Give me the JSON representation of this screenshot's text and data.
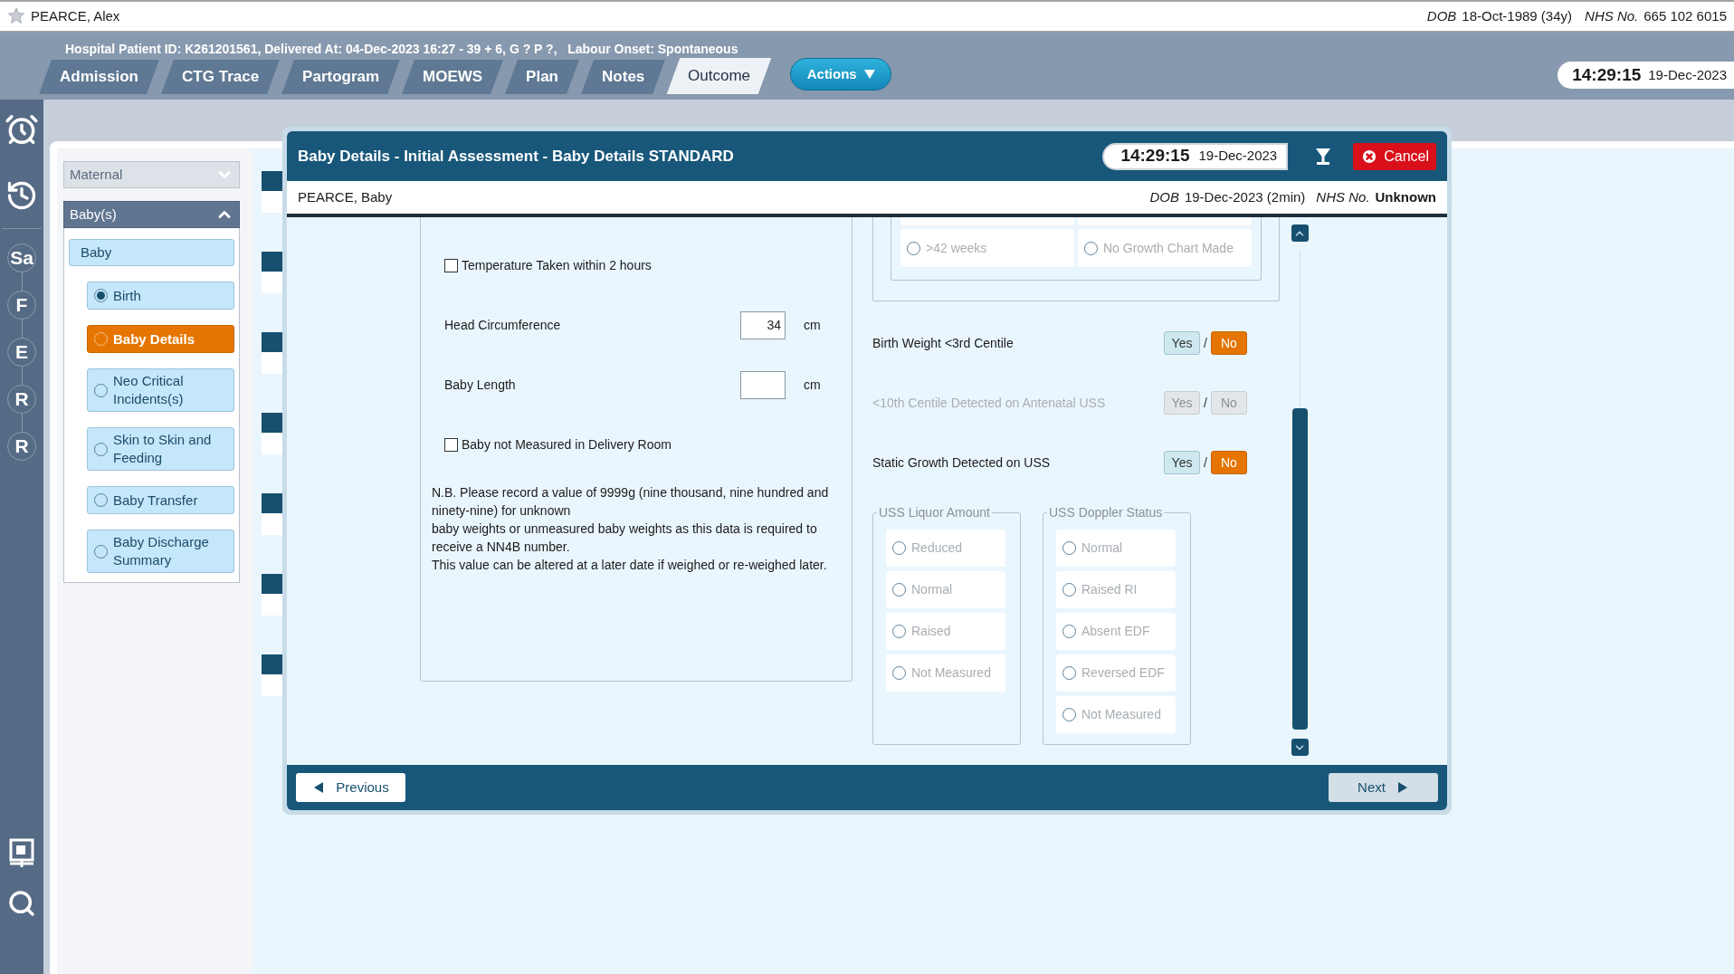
{
  "patient_bar": {
    "name": "PEARCE, Alex",
    "dob_label": "DOB",
    "dob": "18-Oct-1989 (34y)",
    "nhs_label": "NHS No.",
    "nhs": "665 102 6015"
  },
  "info_line": "Hospital Patient ID: K261201561, Delivered At: 04-Dec-2023 16:27 - 39 + 6, G ? P ?,   Labour Onset: Spontaneous",
  "tabs": [
    {
      "label": "Admission",
      "selected": false
    },
    {
      "label": "CTG Trace",
      "selected": false
    },
    {
      "label": "Partogram",
      "selected": false
    },
    {
      "label": "MOEWS",
      "selected": false
    },
    {
      "label": "Plan",
      "selected": false
    },
    {
      "label": "Notes",
      "selected": false
    },
    {
      "label": "Outcome",
      "selected": true
    }
  ],
  "actions_button": "Actions",
  "clock": {
    "time": "14:29:15",
    "date": "19-Dec-2023"
  },
  "rail_letters": [
    "Sa",
    "F",
    "E",
    "R",
    "R"
  ],
  "nav": {
    "sections": [
      {
        "label": "Maternal",
        "expanded": false
      },
      {
        "label": "Baby(s)",
        "expanded": true
      }
    ],
    "baby": "Baby",
    "items": [
      {
        "label": "Birth",
        "checked": true,
        "selected": false
      },
      {
        "label": "Baby Details",
        "checked": false,
        "selected": true
      },
      {
        "label": "Neo Critical Incidents(s)",
        "checked": false,
        "selected": false
      },
      {
        "label": "Skin to Skin and Feeding",
        "checked": false,
        "selected": false
      },
      {
        "label": "Baby Transfer",
        "checked": false,
        "selected": false
      },
      {
        "label": "Baby Discharge Summary",
        "checked": false,
        "selected": false
      }
    ]
  },
  "dialog": {
    "title": "Baby Details - Initial Assessment - Baby Details STANDARD",
    "clock": {
      "time": "14:29:15",
      "date": "19-Dec-2023"
    },
    "cancel": "Cancel",
    "baby": {
      "name": "PEARCE, Baby",
      "dob_label": "DOB",
      "dob": "19-Dec-2023 (2min)",
      "nhs_label": "NHS No.",
      "nhs": "Unknown"
    },
    "fields": [
      {
        "kind": "checkbox",
        "label": "Temperature Taken within 2 hours",
        "checked": false
      },
      {
        "kind": "number",
        "label": "Head Circumference",
        "value": "34",
        "unit": "cm"
      },
      {
        "kind": "number",
        "label": "Baby Length",
        "unit": "cm"
      },
      {
        "kind": "checkbox",
        "label": "Baby not Measured in Delivery Room",
        "checked": false
      }
    ],
    "note": [
      "N.B. Please record a value of 9999g (nine thousand, nine hundred and ninety-nine) for unknown",
      "baby weights or unmeasured baby weights as this data is required to receive a NN4B number.",
      "This value can be altered at a later date if weighed or re-weighed later."
    ],
    "growth_options": [
      {
        "label": ">42 weeks",
        "checked": false,
        "disabled": true
      },
      {
        "label": "No Growth Chart Made",
        "checked": false,
        "disabled": true
      }
    ],
    "yes_no": [
      {
        "label": "Birth Weight <3rd Centile",
        "disabled": false,
        "separator": "/",
        "options": [
          {
            "label": "Yes",
            "selected": false
          },
          {
            "label": "No",
            "selected": true
          }
        ]
      },
      {
        "label": "<10th Centile Detected on Antenatal USS",
        "disabled": true,
        "separator": "/",
        "options": [
          {
            "label": "Yes",
            "selected": false
          },
          {
            "label": "No",
            "selected": false
          }
        ]
      },
      {
        "label": "Static Growth Detected on USS",
        "disabled": false,
        "separator": "/",
        "options": [
          {
            "label": "Yes",
            "selected": false
          },
          {
            "label": "No",
            "selected": true
          }
        ]
      }
    ],
    "groups": [
      {
        "legend": "USS Liquor Amount",
        "disabled": true,
        "options": [
          {
            "label": "Reduced",
            "checked": false
          },
          {
            "label": "Normal",
            "checked": false
          },
          {
            "label": "Raised",
            "checked": false
          },
          {
            "label": "Not Measured",
            "checked": false
          }
        ]
      },
      {
        "legend": "USS Doppler Status",
        "disabled": true,
        "options": [
          {
            "label": "Normal",
            "checked": false
          },
          {
            "label": "Raised RI",
            "checked": false
          },
          {
            "label": "Absent EDF",
            "checked": false
          },
          {
            "label": "Reversed EDF",
            "checked": false
          },
          {
            "label": "Not Measured",
            "checked": false
          }
        ]
      }
    ],
    "previous": "Previous",
    "next": "Next"
  }
}
